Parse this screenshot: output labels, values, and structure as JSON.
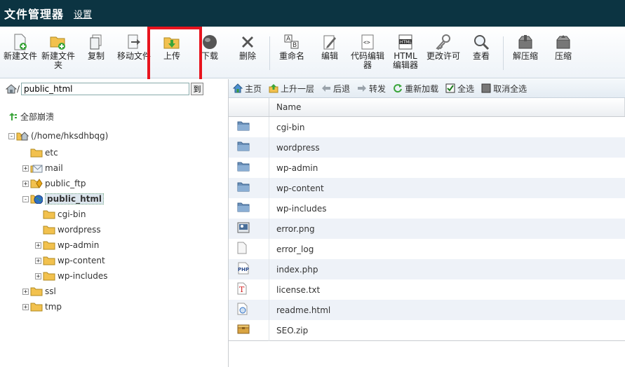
{
  "header": {
    "title": "文件管理器",
    "settings": "设置"
  },
  "toolbar": {
    "buttons": [
      {
        "label": "新建文件",
        "icon": "new-file-icon"
      },
      {
        "label": "新建文件\n夹",
        "icon": "new-folder-icon"
      },
      {
        "label": "复制",
        "icon": "copy-icon"
      },
      {
        "label": "移动文件",
        "icon": "move-file-icon"
      },
      {
        "label": "上传",
        "icon": "upload-icon"
      },
      {
        "label": "下载",
        "icon": "download-icon"
      },
      {
        "label": "删除",
        "icon": "delete-icon"
      },
      {
        "label": "重命名",
        "icon": "rename-icon"
      },
      {
        "label": "编辑",
        "icon": "edit-icon"
      },
      {
        "label": "代码编辑\n器",
        "icon": "code-editor-icon"
      },
      {
        "label": "HTML\n编辑器",
        "icon": "html-editor-icon"
      },
      {
        "label": "更改许可",
        "icon": "change-permissions-icon"
      },
      {
        "label": "查看",
        "icon": "view-icon"
      },
      {
        "label": "解压缩",
        "icon": "extract-icon"
      },
      {
        "label": "压缩",
        "icon": "compress-icon"
      }
    ]
  },
  "left": {
    "path_value": "public_html",
    "path_prefix": "/",
    "go_label": "到",
    "collapse_all": "全部崩溃",
    "tree": [
      {
        "name": "(/home/hksdhbqg)",
        "depth": 0,
        "toggle": "-",
        "icon": "home"
      },
      {
        "name": "etc",
        "depth": 1,
        "toggle": "",
        "icon": "folder"
      },
      {
        "name": "mail",
        "depth": 1,
        "toggle": "+",
        "icon": "mail"
      },
      {
        "name": "public_ftp",
        "depth": 1,
        "toggle": "+",
        "icon": "ftp"
      },
      {
        "name": "public_html",
        "depth": 1,
        "toggle": "-",
        "icon": "globe",
        "selected": true
      },
      {
        "name": "cgi-bin",
        "depth": 2,
        "toggle": "",
        "icon": "folder"
      },
      {
        "name": "wordpress",
        "depth": 2,
        "toggle": "",
        "icon": "folder"
      },
      {
        "name": "wp-admin",
        "depth": 2,
        "toggle": "+",
        "icon": "folder"
      },
      {
        "name": "wp-content",
        "depth": 2,
        "toggle": "+",
        "icon": "folder"
      },
      {
        "name": "wp-includes",
        "depth": 2,
        "toggle": "+",
        "icon": "folder"
      },
      {
        "name": "ssl",
        "depth": 1,
        "toggle": "+",
        "icon": "folder"
      },
      {
        "name": "tmp",
        "depth": 1,
        "toggle": "+",
        "icon": "folder"
      }
    ]
  },
  "nav": {
    "home": "主页",
    "up": "上升一层",
    "back": "后退",
    "forward": "转发",
    "reload": "重新加载",
    "select_all": "全选",
    "deselect_all": "取消全选"
  },
  "files": {
    "header_name": "Name",
    "rows": [
      {
        "name": "cgi-bin",
        "type": "folder"
      },
      {
        "name": "wordpress",
        "type": "folder"
      },
      {
        "name": "wp-admin",
        "type": "folder"
      },
      {
        "name": "wp-content",
        "type": "folder"
      },
      {
        "name": "wp-includes",
        "type": "folder"
      },
      {
        "name": "error.png",
        "type": "image"
      },
      {
        "name": "error_log",
        "type": "file"
      },
      {
        "name": "index.php",
        "type": "php"
      },
      {
        "name": "license.txt",
        "type": "text"
      },
      {
        "name": "readme.html",
        "type": "html"
      },
      {
        "name": "SEO.zip",
        "type": "zip"
      }
    ]
  },
  "colors": {
    "header_bg": "#0c3442",
    "highlight": "#e8141e",
    "folder": "#f2c14e",
    "dir_blue": "#6a8fb8"
  }
}
